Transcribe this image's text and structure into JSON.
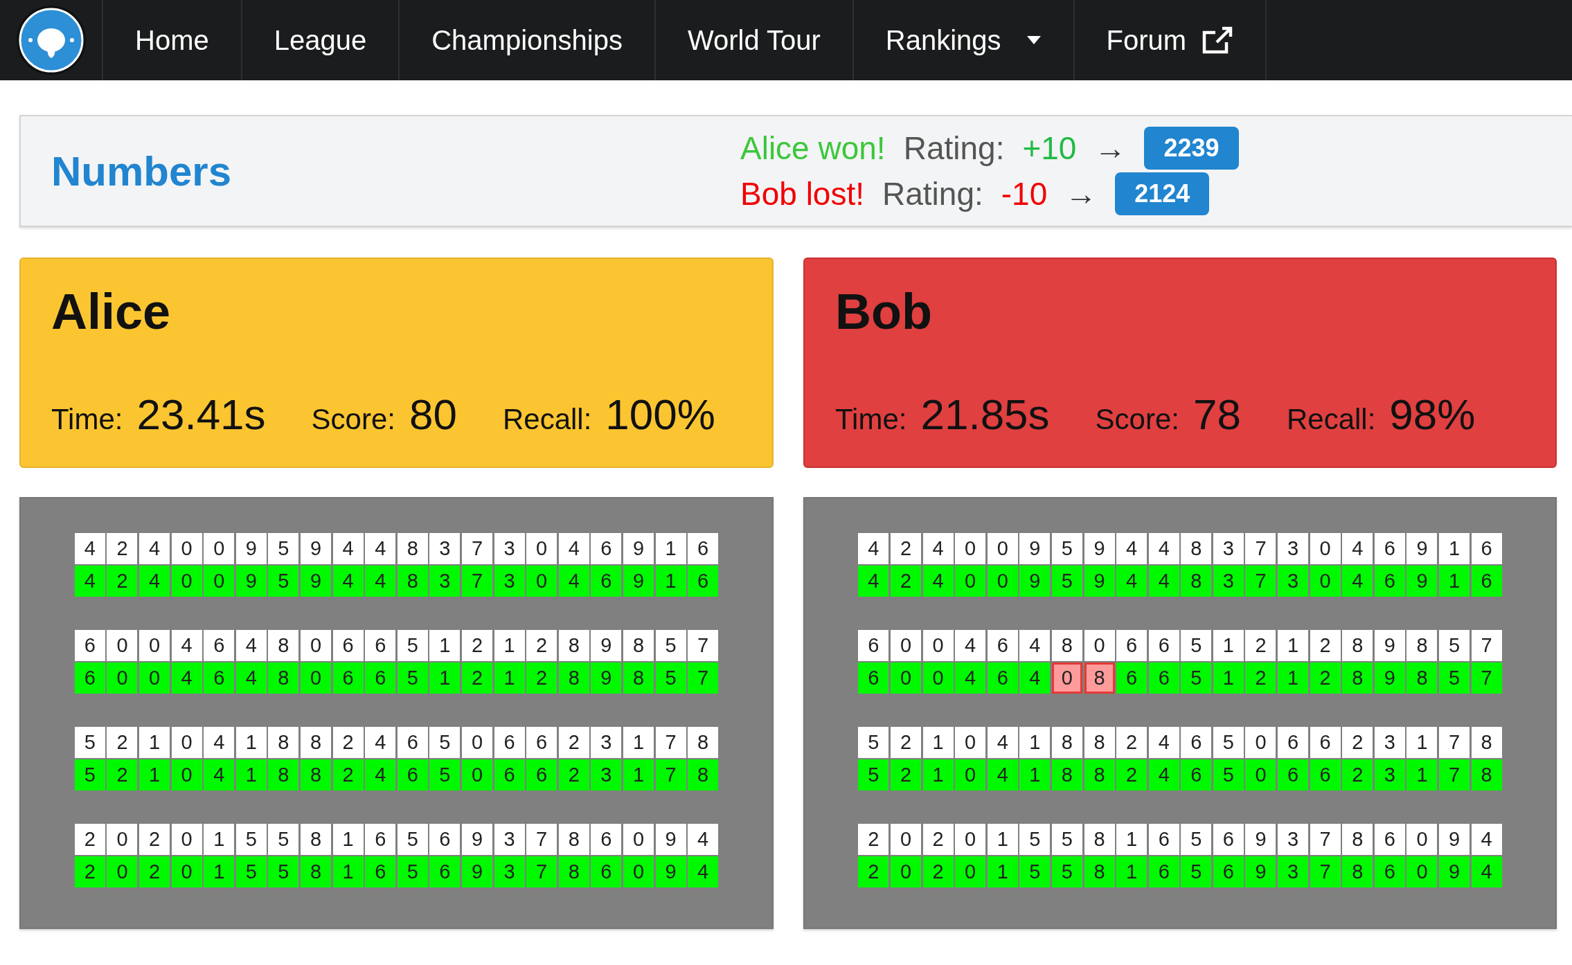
{
  "nav": {
    "items": [
      {
        "label": "Home",
        "kind": "link"
      },
      {
        "label": "League",
        "kind": "link"
      },
      {
        "label": "Championships",
        "kind": "link"
      },
      {
        "label": "World Tour",
        "kind": "link"
      },
      {
        "label": "Rankings",
        "kind": "dropdown"
      },
      {
        "label": "Forum",
        "kind": "external"
      }
    ]
  },
  "event": {
    "title": "Numbers",
    "results": [
      {
        "outcome": "Alice won!",
        "kind": "win",
        "label": "Rating:",
        "change": "+10",
        "arrow": "→",
        "rating": "2239"
      },
      {
        "outcome": "Bob lost!",
        "kind": "loss",
        "label": "Rating:",
        "change": "-10",
        "arrow": "→",
        "rating": "2124"
      }
    ]
  },
  "players": [
    {
      "name": "Alice",
      "kind": "win",
      "stats": [
        {
          "label": "Time:",
          "value": "23.41s"
        },
        {
          "label": "Score:",
          "value": "80"
        },
        {
          "label": "Recall:",
          "value": "100%"
        }
      ],
      "groups": [
        {
          "given": [
            "4",
            "2",
            "4",
            "0",
            "0",
            "9",
            "5",
            "9",
            "4",
            "4",
            "8",
            "3",
            "7",
            "3",
            "0",
            "4",
            "6",
            "9",
            "1",
            "6"
          ],
          "recalled": [
            {
              "digit": "4",
              "correct": true
            },
            {
              "digit": "2",
              "correct": true
            },
            {
              "digit": "4",
              "correct": true
            },
            {
              "digit": "0",
              "correct": true
            },
            {
              "digit": "0",
              "correct": true
            },
            {
              "digit": "9",
              "correct": true
            },
            {
              "digit": "5",
              "correct": true
            },
            {
              "digit": "9",
              "correct": true
            },
            {
              "digit": "4",
              "correct": true
            },
            {
              "digit": "4",
              "correct": true
            },
            {
              "digit": "8",
              "correct": true
            },
            {
              "digit": "3",
              "correct": true
            },
            {
              "digit": "7",
              "correct": true
            },
            {
              "digit": "3",
              "correct": true
            },
            {
              "digit": "0",
              "correct": true
            },
            {
              "digit": "4",
              "correct": true
            },
            {
              "digit": "6",
              "correct": true
            },
            {
              "digit": "9",
              "correct": true
            },
            {
              "digit": "1",
              "correct": true
            },
            {
              "digit": "6",
              "correct": true
            }
          ]
        },
        {
          "given": [
            "6",
            "0",
            "0",
            "4",
            "6",
            "4",
            "8",
            "0",
            "6",
            "6",
            "5",
            "1",
            "2",
            "1",
            "2",
            "8",
            "9",
            "8",
            "5",
            "7"
          ],
          "recalled": [
            {
              "digit": "6",
              "correct": true
            },
            {
              "digit": "0",
              "correct": true
            },
            {
              "digit": "0",
              "correct": true
            },
            {
              "digit": "4",
              "correct": true
            },
            {
              "digit": "6",
              "correct": true
            },
            {
              "digit": "4",
              "correct": true
            },
            {
              "digit": "8",
              "correct": true
            },
            {
              "digit": "0",
              "correct": true
            },
            {
              "digit": "6",
              "correct": true
            },
            {
              "digit": "6",
              "correct": true
            },
            {
              "digit": "5",
              "correct": true
            },
            {
              "digit": "1",
              "correct": true
            },
            {
              "digit": "2",
              "correct": true
            },
            {
              "digit": "1",
              "correct": true
            },
            {
              "digit": "2",
              "correct": true
            },
            {
              "digit": "8",
              "correct": true
            },
            {
              "digit": "9",
              "correct": true
            },
            {
              "digit": "8",
              "correct": true
            },
            {
              "digit": "5",
              "correct": true
            },
            {
              "digit": "7",
              "correct": true
            }
          ]
        },
        {
          "given": [
            "5",
            "2",
            "1",
            "0",
            "4",
            "1",
            "8",
            "8",
            "2",
            "4",
            "6",
            "5",
            "0",
            "6",
            "6",
            "2",
            "3",
            "1",
            "7",
            "8"
          ],
          "recalled": [
            {
              "digit": "5",
              "correct": true
            },
            {
              "digit": "2",
              "correct": true
            },
            {
              "digit": "1",
              "correct": true
            },
            {
              "digit": "0",
              "correct": true
            },
            {
              "digit": "4",
              "correct": true
            },
            {
              "digit": "1",
              "correct": true
            },
            {
              "digit": "8",
              "correct": true
            },
            {
              "digit": "8",
              "correct": true
            },
            {
              "digit": "2",
              "correct": true
            },
            {
              "digit": "4",
              "correct": true
            },
            {
              "digit": "6",
              "correct": true
            },
            {
              "digit": "5",
              "correct": true
            },
            {
              "digit": "0",
              "correct": true
            },
            {
              "digit": "6",
              "correct": true
            },
            {
              "digit": "6",
              "correct": true
            },
            {
              "digit": "2",
              "correct": true
            },
            {
              "digit": "3",
              "correct": true
            },
            {
              "digit": "1",
              "correct": true
            },
            {
              "digit": "7",
              "correct": true
            },
            {
              "digit": "8",
              "correct": true
            }
          ]
        },
        {
          "given": [
            "2",
            "0",
            "2",
            "0",
            "1",
            "5",
            "5",
            "8",
            "1",
            "6",
            "5",
            "6",
            "9",
            "3",
            "7",
            "8",
            "6",
            "0",
            "9",
            "4"
          ],
          "recalled": [
            {
              "digit": "2",
              "correct": true
            },
            {
              "digit": "0",
              "correct": true
            },
            {
              "digit": "2",
              "correct": true
            },
            {
              "digit": "0",
              "correct": true
            },
            {
              "digit": "1",
              "correct": true
            },
            {
              "digit": "5",
              "correct": true
            },
            {
              "digit": "5",
              "correct": true
            },
            {
              "digit": "8",
              "correct": true
            },
            {
              "digit": "1",
              "correct": true
            },
            {
              "digit": "6",
              "correct": true
            },
            {
              "digit": "5",
              "correct": true
            },
            {
              "digit": "6",
              "correct": true
            },
            {
              "digit": "9",
              "correct": true
            },
            {
              "digit": "3",
              "correct": true
            },
            {
              "digit": "7",
              "correct": true
            },
            {
              "digit": "8",
              "correct": true
            },
            {
              "digit": "6",
              "correct": true
            },
            {
              "digit": "0",
              "correct": true
            },
            {
              "digit": "9",
              "correct": true
            },
            {
              "digit": "4",
              "correct": true
            }
          ]
        }
      ]
    },
    {
      "name": "Bob",
      "kind": "loss",
      "stats": [
        {
          "label": "Time:",
          "value": "21.85s"
        },
        {
          "label": "Score:",
          "value": "78"
        },
        {
          "label": "Recall:",
          "value": "98%"
        }
      ],
      "groups": [
        {
          "given": [
            "4",
            "2",
            "4",
            "0",
            "0",
            "9",
            "5",
            "9",
            "4",
            "4",
            "8",
            "3",
            "7",
            "3",
            "0",
            "4",
            "6",
            "9",
            "1",
            "6"
          ],
          "recalled": [
            {
              "digit": "4",
              "correct": true
            },
            {
              "digit": "2",
              "correct": true
            },
            {
              "digit": "4",
              "correct": true
            },
            {
              "digit": "0",
              "correct": true
            },
            {
              "digit": "0",
              "correct": true
            },
            {
              "digit": "9",
              "correct": true
            },
            {
              "digit": "5",
              "correct": true
            },
            {
              "digit": "9",
              "correct": true
            },
            {
              "digit": "4",
              "correct": true
            },
            {
              "digit": "4",
              "correct": true
            },
            {
              "digit": "8",
              "correct": true
            },
            {
              "digit": "3",
              "correct": true
            },
            {
              "digit": "7",
              "correct": true
            },
            {
              "digit": "3",
              "correct": true
            },
            {
              "digit": "0",
              "correct": true
            },
            {
              "digit": "4",
              "correct": true
            },
            {
              "digit": "6",
              "correct": true
            },
            {
              "digit": "9",
              "correct": true
            },
            {
              "digit": "1",
              "correct": true
            },
            {
              "digit": "6",
              "correct": true
            }
          ]
        },
        {
          "given": [
            "6",
            "0",
            "0",
            "4",
            "6",
            "4",
            "8",
            "0",
            "6",
            "6",
            "5",
            "1",
            "2",
            "1",
            "2",
            "8",
            "9",
            "8",
            "5",
            "7"
          ],
          "recalled": [
            {
              "digit": "6",
              "correct": true
            },
            {
              "digit": "0",
              "correct": true
            },
            {
              "digit": "0",
              "correct": true
            },
            {
              "digit": "4",
              "correct": true
            },
            {
              "digit": "6",
              "correct": true
            },
            {
              "digit": "4",
              "correct": true
            },
            {
              "digit": "0",
              "correct": false
            },
            {
              "digit": "8",
              "correct": false
            },
            {
              "digit": "6",
              "correct": true
            },
            {
              "digit": "6",
              "correct": true
            },
            {
              "digit": "5",
              "correct": true
            },
            {
              "digit": "1",
              "correct": true
            },
            {
              "digit": "2",
              "correct": true
            },
            {
              "digit": "1",
              "correct": true
            },
            {
              "digit": "2",
              "correct": true
            },
            {
              "digit": "8",
              "correct": true
            },
            {
              "digit": "9",
              "correct": true
            },
            {
              "digit": "8",
              "correct": true
            },
            {
              "digit": "5",
              "correct": true
            },
            {
              "digit": "7",
              "correct": true
            }
          ]
        },
        {
          "given": [
            "5",
            "2",
            "1",
            "0",
            "4",
            "1",
            "8",
            "8",
            "2",
            "4",
            "6",
            "5",
            "0",
            "6",
            "6",
            "2",
            "3",
            "1",
            "7",
            "8"
          ],
          "recalled": [
            {
              "digit": "5",
              "correct": true
            },
            {
              "digit": "2",
              "correct": true
            },
            {
              "digit": "1",
              "correct": true
            },
            {
              "digit": "0",
              "correct": true
            },
            {
              "digit": "4",
              "correct": true
            },
            {
              "digit": "1",
              "correct": true
            },
            {
              "digit": "8",
              "correct": true
            },
            {
              "digit": "8",
              "correct": true
            },
            {
              "digit": "2",
              "correct": true
            },
            {
              "digit": "4",
              "correct": true
            },
            {
              "digit": "6",
              "correct": true
            },
            {
              "digit": "5",
              "correct": true
            },
            {
              "digit": "0",
              "correct": true
            },
            {
              "digit": "6",
              "correct": true
            },
            {
              "digit": "6",
              "correct": true
            },
            {
              "digit": "2",
              "correct": true
            },
            {
              "digit": "3",
              "correct": true
            },
            {
              "digit": "1",
              "correct": true
            },
            {
              "digit": "7",
              "correct": true
            },
            {
              "digit": "8",
              "correct": true
            }
          ]
        },
        {
          "given": [
            "2",
            "0",
            "2",
            "0",
            "1",
            "5",
            "5",
            "8",
            "1",
            "6",
            "5",
            "6",
            "9",
            "3",
            "7",
            "8",
            "6",
            "0",
            "9",
            "4"
          ],
          "recalled": [
            {
              "digit": "2",
              "correct": true
            },
            {
              "digit": "0",
              "correct": true
            },
            {
              "digit": "2",
              "correct": true
            },
            {
              "digit": "0",
              "correct": true
            },
            {
              "digit": "1",
              "correct": true
            },
            {
              "digit": "5",
              "correct": true
            },
            {
              "digit": "5",
              "correct": true
            },
            {
              "digit": "8",
              "correct": true
            },
            {
              "digit": "1",
              "correct": true
            },
            {
              "digit": "6",
              "correct": true
            },
            {
              "digit": "5",
              "correct": true
            },
            {
              "digit": "6",
              "correct": true
            },
            {
              "digit": "9",
              "correct": true
            },
            {
              "digit": "3",
              "correct": true
            },
            {
              "digit": "7",
              "correct": true
            },
            {
              "digit": "8",
              "correct": true
            },
            {
              "digit": "6",
              "correct": true
            },
            {
              "digit": "0",
              "correct": true
            },
            {
              "digit": "9",
              "correct": true
            },
            {
              "digit": "4",
              "correct": true
            }
          ]
        }
      ]
    }
  ]
}
